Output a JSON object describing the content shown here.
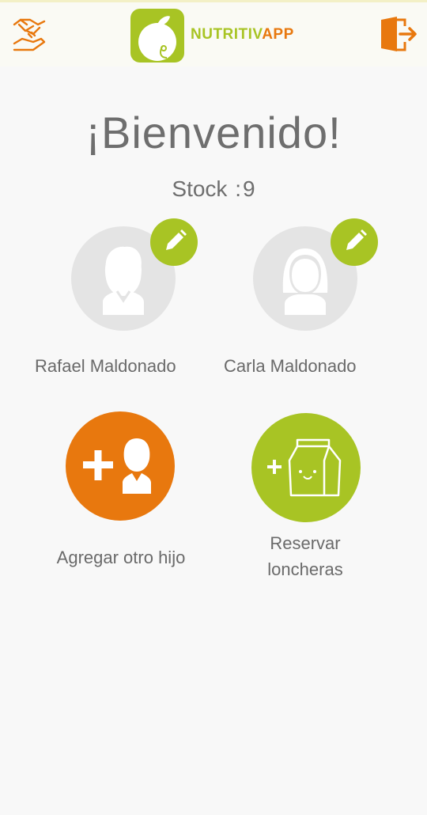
{
  "header": {
    "brand_part1": "NUTRITIV",
    "brand_part2": "APP",
    "left_icon": "handshake-icon",
    "right_icon": "exit-door-icon",
    "brand_green": "#a8c424",
    "brand_orange": "#e8780e"
  },
  "main": {
    "welcome": "¡Bienvenido!",
    "stock_label": "Stock",
    "stock_separator": ":",
    "stock_value": "9"
  },
  "children": [
    {
      "name": "Rafael Maldonado",
      "avatar": "boy-avatar-icon"
    },
    {
      "name": "Carla Maldonado",
      "avatar": "girl-avatar-icon"
    }
  ],
  "actions": {
    "add_child": "Agregar otro hijo",
    "reserve_line1": "Reservar",
    "reserve_line2": "loncheras"
  }
}
